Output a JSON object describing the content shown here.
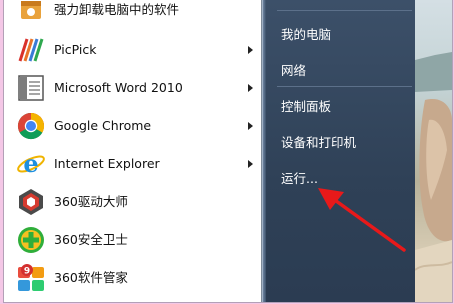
{
  "programs": [
    {
      "label": "强力卸载电脑中的软件",
      "icon": "uninstall-box-icon",
      "submenu": false
    },
    {
      "label": "PicPick",
      "icon": "picpick-icon",
      "submenu": true
    },
    {
      "label": "Microsoft Word 2010",
      "icon": "word-document-icon",
      "submenu": true
    },
    {
      "label": "Google Chrome",
      "icon": "chrome-icon",
      "submenu": true
    },
    {
      "label": "Internet Explorer",
      "icon": "internet-explorer-icon",
      "submenu": true
    },
    {
      "label": "360驱动大师",
      "icon": "360-driver-master-icon",
      "submenu": false
    },
    {
      "label": "360安全卫士",
      "icon": "360-security-icon",
      "submenu": false
    },
    {
      "label": "360软件管家",
      "icon": "360-software-manager-icon",
      "submenu": false
    }
  ],
  "badge": "9",
  "places": {
    "my_computer": "我的电脑",
    "network": "网络",
    "control_panel": "控制面板",
    "devices_printers": "设备和打印机",
    "run": "运行..."
  },
  "colors": {
    "arrow": "#e8191a",
    "panel_dark": "#34475e",
    "background_pink": "#f4c7e6"
  }
}
